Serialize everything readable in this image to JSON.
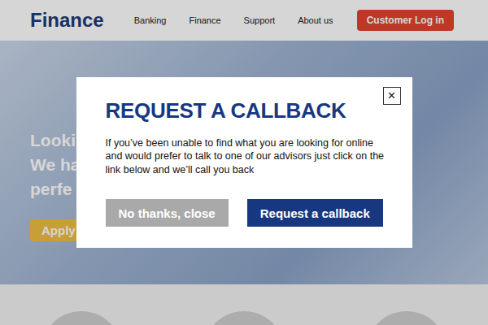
{
  "header": {
    "logo": "Finance",
    "nav": [
      "Banking",
      "Finance",
      "Support",
      "About us"
    ],
    "login": "Customer Log in"
  },
  "hero": {
    "lines": [
      "Looki",
      "We ha",
      "perfe"
    ],
    "button": "Apply"
  },
  "dialog": {
    "title": "REQUEST A CALLBACK",
    "close": "×",
    "body": "If you’ve been unable to find what you are looking for online and would prefer to talk to one of our advisors just click on the link below and we’ll call you back",
    "buttons": [
      {
        "label": "No thanks, close",
        "kind": "secondary"
      },
      {
        "label": "Request a callback",
        "kind": "primary"
      }
    ]
  }
}
